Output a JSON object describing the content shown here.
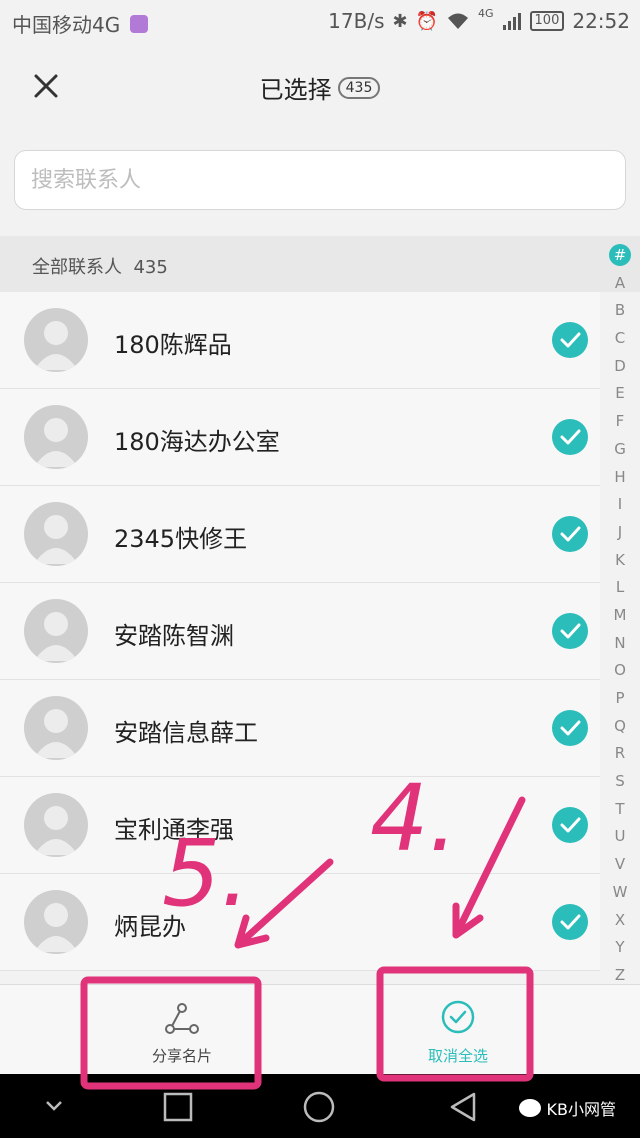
{
  "status_bar": {
    "carrier": "中国移动4G",
    "speed": "17B/s",
    "network": "4G",
    "battery": "100",
    "time": "22:52"
  },
  "header": {
    "title": "已选择",
    "count": "435"
  },
  "search": {
    "placeholder": "搜索联系人"
  },
  "section": {
    "label": "全部联系人",
    "count": "435"
  },
  "contacts": [
    {
      "name": "180陈辉品",
      "selected": true
    },
    {
      "name": "180海达办公室",
      "selected": true
    },
    {
      "name": "2345快修王",
      "selected": true
    },
    {
      "name": "安踏陈智渊",
      "selected": true
    },
    {
      "name": "安踏信息薛工",
      "selected": true
    },
    {
      "name": "宝利通李强",
      "selected": true
    },
    {
      "name": "炳昆办",
      "selected": true
    }
  ],
  "index_bar": [
    "#",
    "A",
    "B",
    "C",
    "D",
    "E",
    "F",
    "G",
    "H",
    "I",
    "J",
    "K",
    "L",
    "M",
    "N",
    "O",
    "P",
    "Q",
    "R",
    "S",
    "T",
    "U",
    "V",
    "W",
    "X",
    "Y",
    "Z"
  ],
  "actions": {
    "share_label": "分享名片",
    "deselect_label": "取消全选"
  },
  "annotations": {
    "step5": "5.",
    "step4": "4."
  },
  "watermark": "KB小网管",
  "colors": {
    "accent": "#2bbdba",
    "annotation": "#e0337a",
    "background": "#f2f2f2"
  },
  "icons": [
    "close-icon",
    "share-icon",
    "check-circle-icon",
    "avatar-placeholder-icon",
    "back-nav-icon",
    "home-nav-icon",
    "recent-nav-icon"
  ]
}
